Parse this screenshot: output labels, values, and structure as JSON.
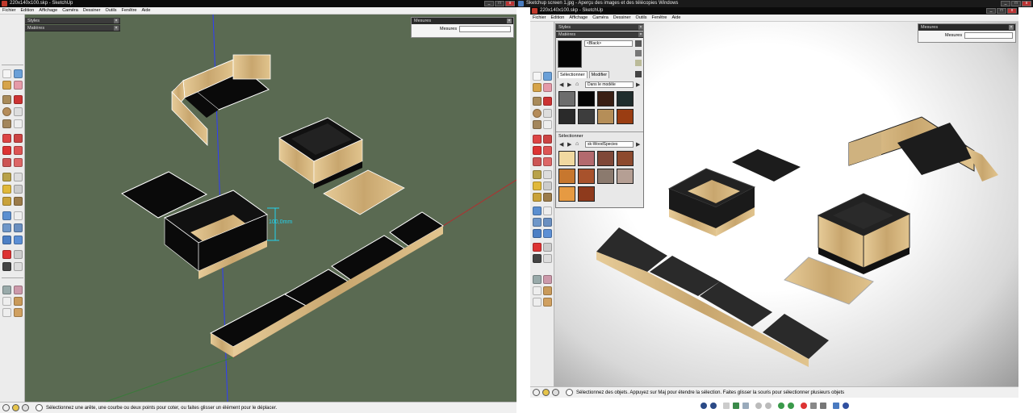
{
  "left_window": {
    "title": "220x140x100.skp - SketchUp",
    "menu": [
      "Fichier",
      "Edition",
      "Affichage",
      "Caméra",
      "Dessiner",
      "Outils",
      "Fenêtre",
      "Aide"
    ],
    "panels": [
      "Styles",
      "Matières"
    ],
    "measure_dialog": {
      "title": "Mesures",
      "label": "Mesures",
      "value": ""
    },
    "dimension_label": "100,0mm",
    "status_text": "Sélectionnez une arête, une courbe ou deux points pour coter, ou faites glisser un élément pour le déplacer."
  },
  "right_window": {
    "outer_title": "Sketchup screen 1.jpg - Aperçu des images et des télécopies Windows",
    "title": "220x140x100.skp - SketchUp",
    "menu": [
      "Fichier",
      "Edition",
      "Affichage",
      "Caméra",
      "Dessiner",
      "Outils",
      "Fenêtre",
      "Aide"
    ],
    "measure_dialog": {
      "title": "Mesures",
      "label": "Mesures",
      "value": ""
    },
    "styles_header": "Styles",
    "materials_header": "Matières",
    "material_name": "<Black>",
    "tabs": [
      "Sélectionner",
      "Modifier"
    ],
    "dropdown1": "Dans le modèle",
    "section2_label": "Sélectionner",
    "dropdown2": "sk-WoodSpecies",
    "status_text": "Sélectionnez des objets. Appuyez sur Maj pour étendre la sélection. Faites glisser la souris pour sélectionner plusieurs objets"
  },
  "colors": {
    "viewport_left": "#5a6a52",
    "wood": "#d9bd8c",
    "black_face": "#0a0a0a",
    "axis_blue": "#2f3cff",
    "axis_red": "#b03030",
    "dimension": "#22d3ee"
  },
  "swatches_model": [
    "#6d6d6d",
    "#050505",
    "#3a1f14",
    "#1f2d2d",
    "#2a2a2a",
    "#3d3d3d",
    "#b58e58",
    "#9a3d12"
  ],
  "swatches_wood": [
    "#f1d9a0",
    "#b36a6e",
    "#7f4838",
    "#8d4a2e",
    "#c7772e",
    "#a8522c",
    "#8b7a6e",
    "#b59f94",
    "#e69a42",
    "#8e3a1c"
  ]
}
